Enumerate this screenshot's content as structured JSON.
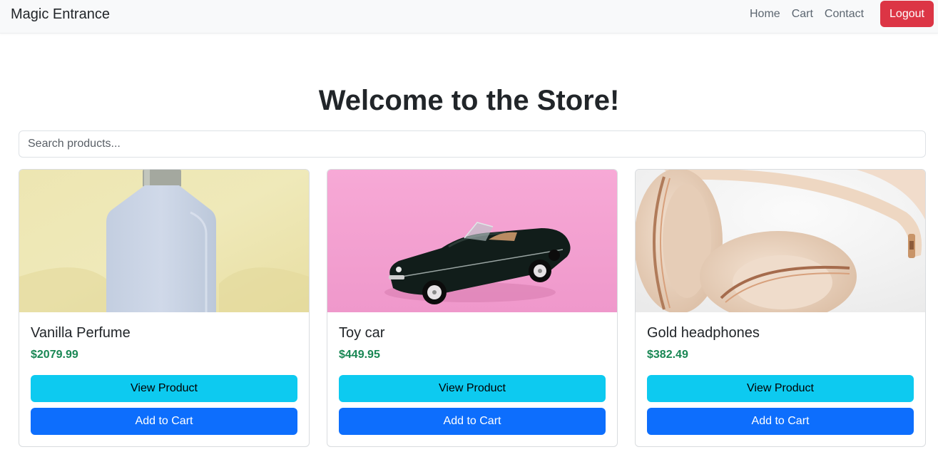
{
  "navbar": {
    "brand": "Magic Entrance",
    "links": [
      "Home",
      "Cart",
      "Contact"
    ],
    "logout_label": "Logout",
    "logout_color": "#dc3545"
  },
  "main": {
    "title": "Welcome to the Store!",
    "search_placeholder": "Search products..."
  },
  "products": [
    {
      "name": "Vanilla Perfume",
      "price": "$2079.99",
      "image": "perfume-bottle-image",
      "view_label": "View Product",
      "cart_label": "Add to Cart"
    },
    {
      "name": "Toy car",
      "price": "$449.95",
      "image": "toy-car-image",
      "view_label": "View Product",
      "cart_label": "Add to Cart"
    },
    {
      "name": "Gold headphones",
      "price": "$382.49",
      "image": "headphones-image",
      "view_label": "View Product",
      "cart_label": "Add to Cart"
    }
  ],
  "colors": {
    "price": "#198754",
    "view_button": "#0dcaf0",
    "cart_button": "#0d6efd"
  }
}
